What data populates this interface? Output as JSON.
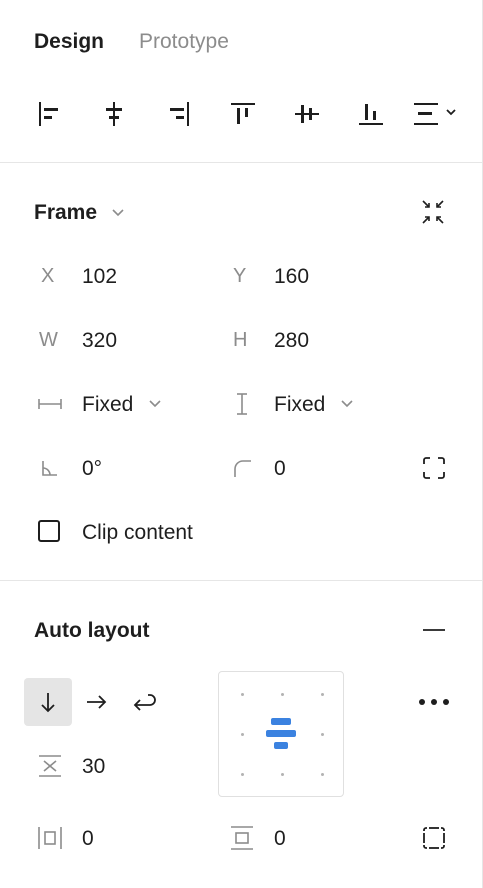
{
  "tabs": {
    "design": "Design",
    "prototype": "Prototype"
  },
  "frame": {
    "title": "Frame",
    "x_label": "X",
    "x_value": "102",
    "y_label": "Y",
    "y_value": "160",
    "w_label": "W",
    "w_value": "320",
    "h_label": "H",
    "h_value": "280",
    "width_mode": "Fixed",
    "height_mode": "Fixed",
    "rotation": "0°",
    "corner_radius": "0",
    "clip_content_label": "Clip content",
    "clip_content_checked": false
  },
  "auto_layout": {
    "title": "Auto layout",
    "gap": "30",
    "horizontal_padding": "0",
    "vertical_padding": "0",
    "direction": "vertical",
    "alignment": "center"
  },
  "colors": {
    "accent": "#3b82e0",
    "text": "#1e1e1e",
    "muted": "#8c8c8c",
    "divider": "#e6e6e6"
  }
}
